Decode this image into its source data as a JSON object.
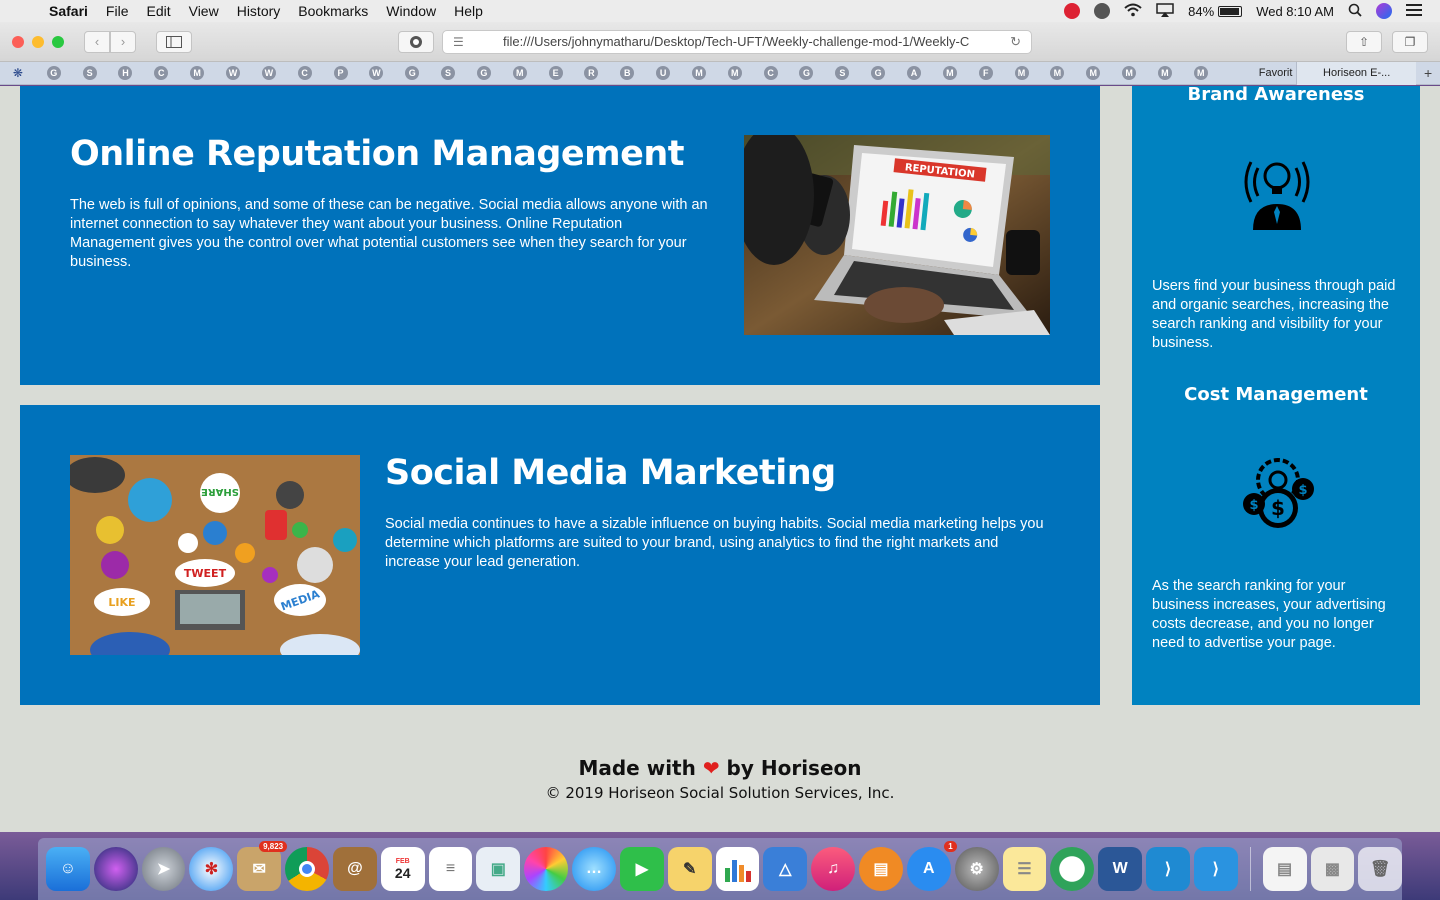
{
  "menubar": {
    "app": "Safari",
    "items": [
      "File",
      "Edit",
      "View",
      "History",
      "Bookmarks",
      "Window",
      "Help"
    ],
    "battery": "84%",
    "clock": "Wed 8:10 AM"
  },
  "browser": {
    "url": "file:///Users/johnymatharu/Desktop/Tech-UFT/Weekly-challenge-mod-1/Weekly-C",
    "bookmarks": [
      "G",
      "S",
      "H",
      "C",
      "M",
      "W",
      "W",
      "C",
      "P",
      "W",
      "G",
      "S",
      "G",
      "M",
      "E",
      "R",
      "B",
      "U",
      "M",
      "M",
      "C",
      "G",
      "S",
      "G",
      "A",
      "M",
      "F",
      "M",
      "M",
      "M",
      "M",
      "M",
      "M"
    ],
    "favorites_label": "Favorit",
    "tab_label": "Horiseon E-..."
  },
  "page": {
    "orm": {
      "title": "Online Reputation Management",
      "body": "The web is full of opinions, and some of these can be negative. Social media allows anyone with an internet connection to say whatever they want about your business. Online Reputation Management gives you the control over what potential customers see when they search for your business.",
      "image_text": "REPUTATION"
    },
    "smm": {
      "title": "Social Media Marketing",
      "body": "Social media continues to have a sizable influence on buying habits. Social media marketing helps you determine which platforms are suited to your brand, using analytics to find the right markets and increase your lead generation.",
      "image_words": [
        "SHARE",
        "TWEET",
        "LIKE",
        "MEDIA"
      ]
    },
    "sidebar": {
      "brand_title": "Brand Awareness",
      "brand_body": "Users find your business through paid and organic searches, increasing the search ranking and visibility for your business.",
      "cost_title": "Cost Management",
      "cost_body": "As the search ranking for your business increases, your advertising costs decrease, and you no longer need to advertise your page."
    },
    "footer": {
      "made_prefix": "Made with",
      "made_suffix": "by Horiseon",
      "copyright": "© 2019 Horiseon Social Solution Services, Inc."
    }
  },
  "dock": {
    "mail_badge": "9,823",
    "calendar_month": "FEB",
    "calendar_day": "24",
    "appstore_badge": "1"
  },
  "colors": {
    "card_blue": "#0072bb",
    "sidebar_blue": "#0082c0",
    "page_bg": "#d9dcd6",
    "heart": "#e0201e"
  }
}
